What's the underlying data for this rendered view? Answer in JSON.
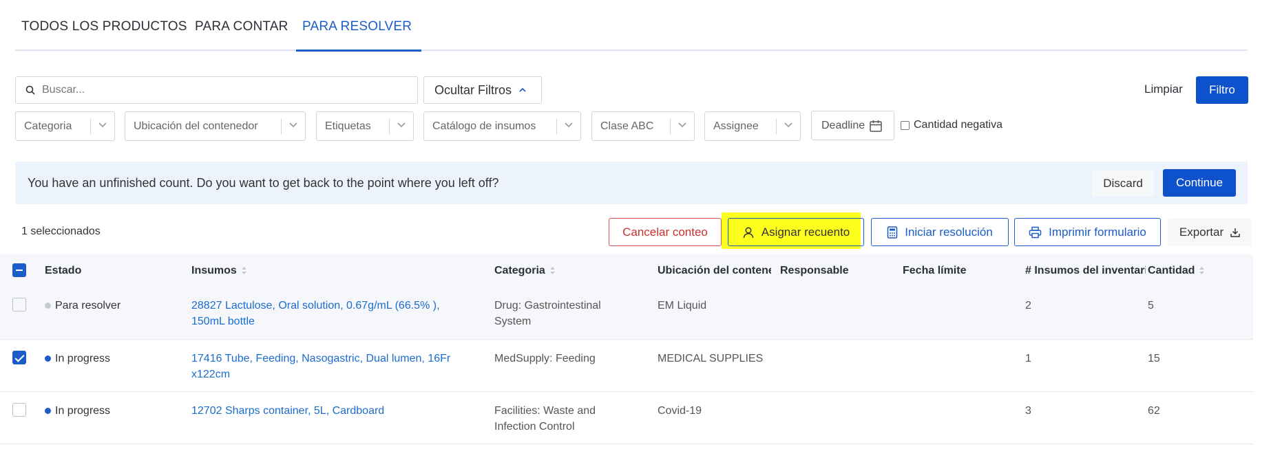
{
  "tabs": [
    {
      "label": "TODOS LOS PRODUCTOS"
    },
    {
      "label": "PARA CONTAR"
    },
    {
      "label": "PARA RESOLVER"
    }
  ],
  "filters": {
    "search_placeholder": "Buscar...",
    "hide_filters_label": "Ocultar Filtros",
    "clear_label": "Limpiar",
    "filter_label": "Filtro",
    "selects": [
      "Categoria",
      "Ubicación del contenedor",
      "Etiquetas",
      "Catálogo de insumos",
      "Clase ABC",
      "Assignee"
    ],
    "deadline_label": "Deadline",
    "negative_qty_label": "Cantidad negativa"
  },
  "banner": {
    "message": "You have an unfinished count. Do you want to get back to the point where you left off?",
    "discard_label": "Discard",
    "continue_label": "Continue"
  },
  "actions": {
    "selected_count": "1 seleccionados",
    "cancel_label": "Cancelar conteo",
    "assign_label": "Asignar recuento",
    "resolve_label": "Iniciar resolución",
    "print_label": "Imprimir formulario",
    "export_label": "Exportar"
  },
  "table": {
    "columns": [
      "Estado",
      "Insumos",
      "Categoria",
      "Ubicación del contenedor",
      "Responsable",
      "Fecha límite",
      "# Insumos del inventario",
      "Cantidad"
    ],
    "rows": [
      {
        "checked": false,
        "status": "Para resolver",
        "status_color": "#c7cad1",
        "item_line1": "28827 Lactulose, Oral solution, 0.67g/mL (66.5% ),",
        "item_line2": "150mL bottle",
        "category_line1": "Drug: Gastrointestinal",
        "category_line2": "System",
        "location": "EM Liquid",
        "responsible": "",
        "deadline": "",
        "inventory_items": "2",
        "quantity": "5"
      },
      {
        "checked": true,
        "status": "In progress",
        "status_color": "#1b5cc8",
        "item_line1": "17416 Tube, Feeding, Nasogastric, Dual lumen, 16Fr",
        "item_line2": "x122cm",
        "category_line1": "MedSupply: Feeding",
        "category_line2": "",
        "location": "MEDICAL SUPPLIES",
        "responsible": "",
        "deadline": "",
        "inventory_items": "1",
        "quantity": "15"
      },
      {
        "checked": false,
        "status": "In progress",
        "status_color": "#1b5cc8",
        "item_line1": "12702 Sharps container, 5L, Cardboard",
        "item_line2": "",
        "category_line1": "Facilities: Waste and",
        "category_line2": "Infection Control",
        "location": "Covid-19",
        "responsible": "",
        "deadline": "",
        "inventory_items": "3",
        "quantity": "62"
      }
    ]
  },
  "colors": {
    "accent": "#1b5cc8",
    "highlight": "#ffff1e",
    "banner_bg": "#edf3fd",
    "danger": "#c9302c"
  }
}
